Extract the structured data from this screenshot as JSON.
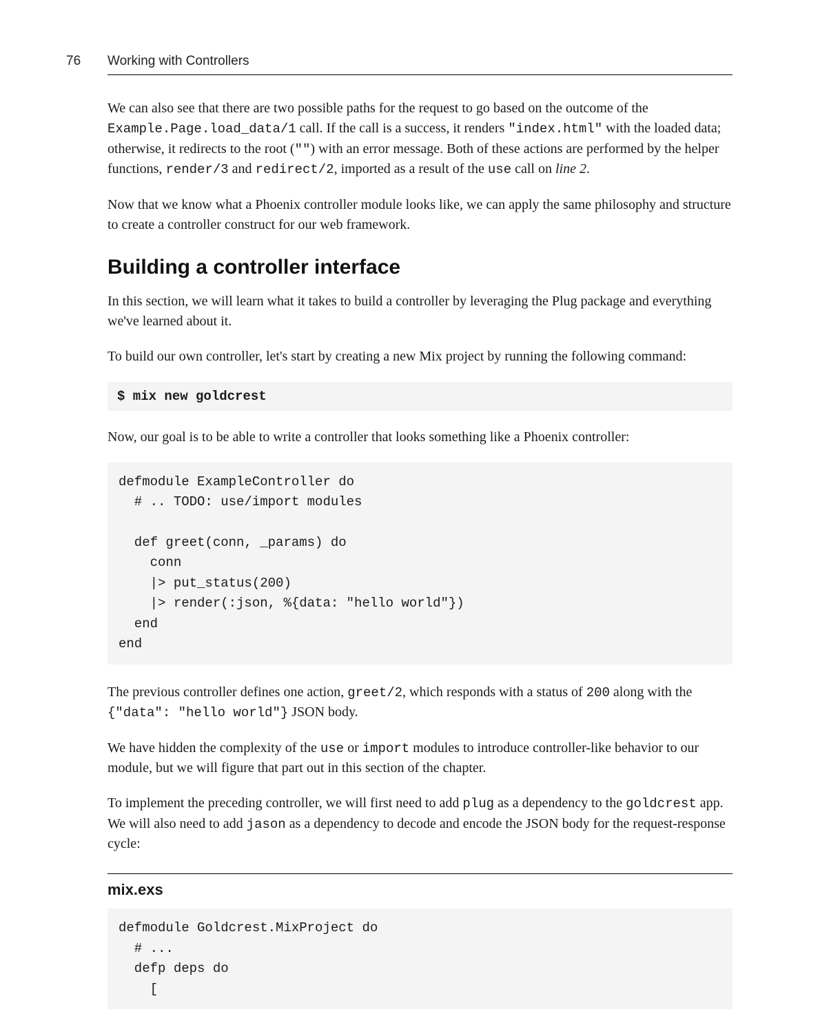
{
  "page_number": "76",
  "running_head": "Working with Controllers",
  "para1_pre": "We can also see that there are two possible paths for the request to go based on the outcome of the ",
  "code1": "Example.Page.load_data/1",
  "para1_mid1": " call. If the call is a success, it renders ",
  "code2": "\"index.html\"",
  "para1_mid2": " with the loaded data; otherwise, it redirects to the root (",
  "code3": "\"\"",
  "para1_mid3": ") with an error message. Both of these actions are performed by the helper functions, ",
  "code4": "render/3",
  "para1_mid4": " and ",
  "code5": "redirect/2",
  "para1_mid5": ", imported as a result of the ",
  "code6": "use",
  "para1_mid6": " call on ",
  "italic1": "line 2",
  "para1_end": ".",
  "para2": "Now that we know what a Phoenix controller module looks like, we can apply the same philosophy and structure to create a controller construct for our web framework.",
  "section_heading": "Building a controller interface",
  "para3": "In this section, we will learn what it takes to build a controller by leveraging the Plug package and everything we've learned about it.",
  "para4": "To build our own controller, let's start by creating a new Mix project by running the following command:",
  "cmd1": "$ mix new goldcrest",
  "para5": "Now, our goal is to be able to write a controller that looks something like a Phoenix controller:",
  "codeblock1": "defmodule ExampleController do\n  # .. TODO: use/import modules\n\n  def greet(conn, _params) do\n    conn\n    |> put_status(200)\n    |> render(:json, %{data: \"hello world\"})\n  end\nend",
  "para6_pre": "The previous controller defines one action, ",
  "code7": "greet/2",
  "para6_mid1": ", which responds with a status of ",
  "code8": "200",
  "para6_mid2": " along with the ",
  "code9": "{\"data\": \"hello world\"}",
  "para6_end": " JSON body.",
  "para7_pre": "We have hidden the complexity of the ",
  "code10": "use",
  "para7_mid1": " or ",
  "code11": "import",
  "para7_end": " modules to introduce controller-like behavior to our module, but we will figure that part out in this section of the chapter.",
  "para8_pre": "To implement the preceding controller, we will first need to add ",
  "code12": "plug",
  "para8_mid1": " as a dependency to the ",
  "code13": "goldcrest",
  "para8_mid2": " app. We will also need to add ",
  "code14": "jason",
  "para8_end": " as a dependency to decode and encode the JSON body for the request-response cycle:",
  "file_name": "mix.exs",
  "codeblock2": "defmodule Goldcrest.MixProject do\n  # ...\n  defp deps do\n    ["
}
